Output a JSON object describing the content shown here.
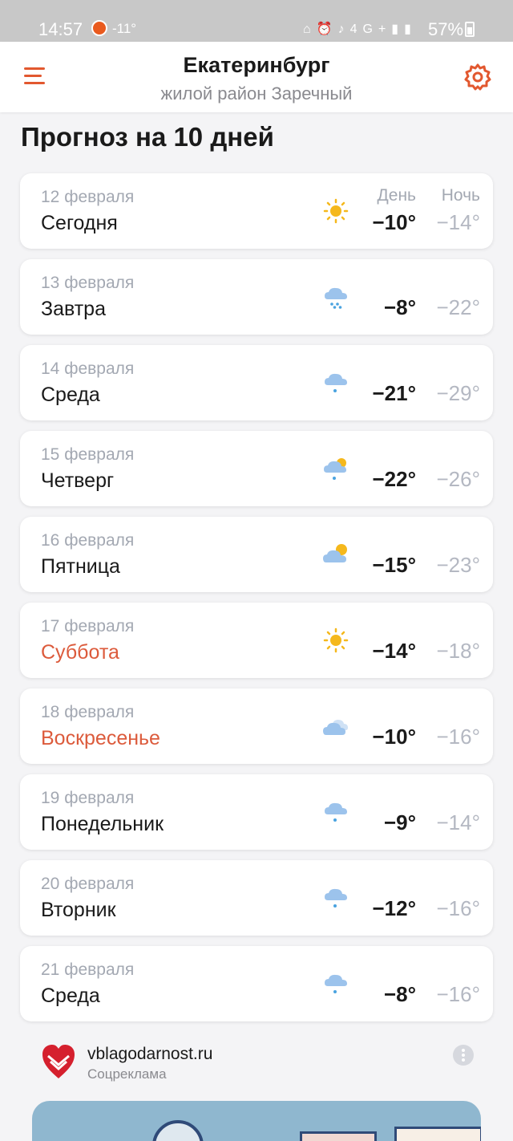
{
  "status_bar": {
    "time": "14:57",
    "weather_temp": "-11°",
    "network_label": "4G+",
    "battery_percent": "57%"
  },
  "header": {
    "city": "Екатеринбург",
    "district": "жилой район Заречный"
  },
  "forecast": {
    "title": "Прогноз на 10 дней",
    "column_day": "День",
    "column_night": "Ночь",
    "days": [
      {
        "date": "12 февраля",
        "day": "Сегодня",
        "icon": "sun-icon",
        "t_day": "−10°",
        "t_night": "−14°",
        "weekend": false
      },
      {
        "date": "13 февраля",
        "day": "Завтра",
        "icon": "cloud-snow-icon",
        "t_day": "−8°",
        "t_night": "−22°",
        "weekend": false
      },
      {
        "date": "14 февраля",
        "day": "Среда",
        "icon": "cloud-light-snow-icon",
        "t_day": "−21°",
        "t_night": "−29°",
        "weekend": false
      },
      {
        "date": "15 февраля",
        "day": "Четверг",
        "icon": "sun-cloud-snow-icon",
        "t_day": "−22°",
        "t_night": "−26°",
        "weekend": false
      },
      {
        "date": "16 февраля",
        "day": "Пятница",
        "icon": "partly-cloudy-icon",
        "t_day": "−15°",
        "t_night": "−23°",
        "weekend": false
      },
      {
        "date": "17 февраля",
        "day": "Суббота",
        "icon": "sun-icon",
        "t_day": "−14°",
        "t_night": "−18°",
        "weekend": true
      },
      {
        "date": "18 февраля",
        "day": "Воскресенье",
        "icon": "cloudy-icon",
        "t_day": "−10°",
        "t_night": "−16°",
        "weekend": true
      },
      {
        "date": "19 февраля",
        "day": "Понедельник",
        "icon": "cloud-light-snow-icon",
        "t_day": "−9°",
        "t_night": "−14°",
        "weekend": false
      },
      {
        "date": "20 февраля",
        "day": "Вторник",
        "icon": "cloud-light-snow-icon",
        "t_day": "−12°",
        "t_night": "−16°",
        "weekend": false
      },
      {
        "date": "21 февраля",
        "day": "Среда",
        "icon": "cloud-light-snow-icon",
        "t_day": "−8°",
        "t_night": "−16°",
        "weekend": false
      }
    ]
  },
  "ad": {
    "domain": "vblagodarnost.ru",
    "label": "Соцреклама"
  },
  "colors": {
    "accent": "#e2582f",
    "weekend": "#dc5b3c",
    "muted": "#a3a8b2",
    "night_temp": "#b4b8c2",
    "sun": "#f5b81c",
    "cloud": "#9cc3ec",
    "snow": "#4aa3e0"
  }
}
